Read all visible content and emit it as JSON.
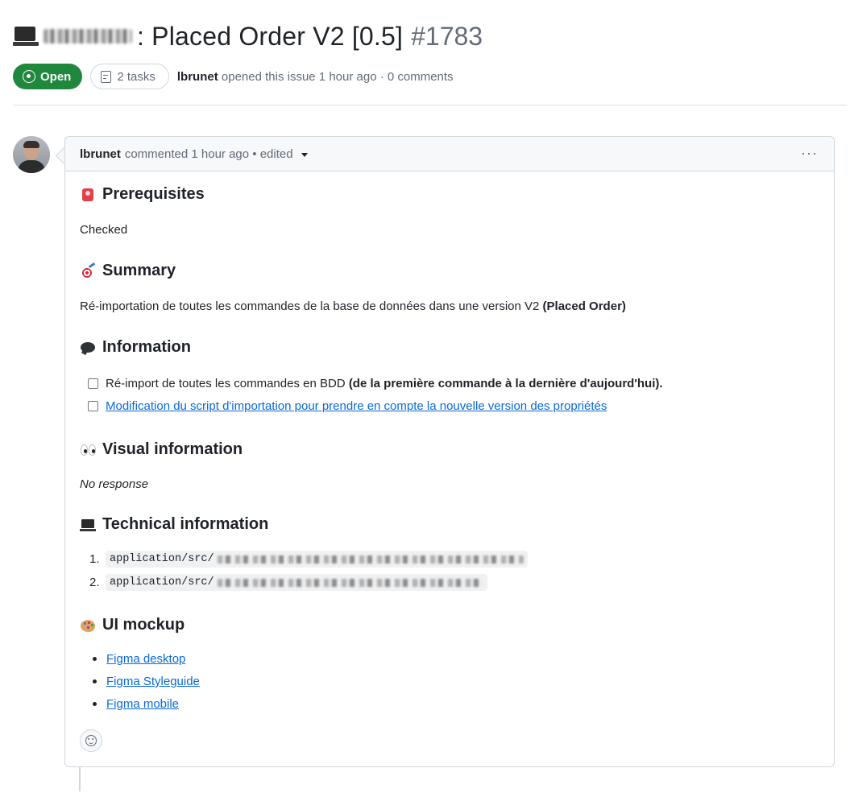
{
  "issue": {
    "title": ": Placed Order V2 [0.5]",
    "number": "#1783",
    "state": "Open",
    "tasks_label": "2 tasks",
    "author": "lbrunet",
    "meta_suffix": "opened this issue 1 hour ago · 0 comments"
  },
  "comment": {
    "author": "lbrunet",
    "meta": "commented 1 hour ago • edited",
    "menu_label": "···",
    "sections": {
      "prerequisites": {
        "title": "Prerequisites",
        "text": "Checked"
      },
      "summary": {
        "title": "Summary",
        "text": "Ré-importation de toutes les commandes de la base de données dans une version V2",
        "bold": "(Placed Order)"
      },
      "information": {
        "title": "Information",
        "tasks": [
          {
            "text": "Ré-import de toutes les commandes en BDD",
            "bold": "(de la première commande à la dernière d'aujourd'hui).",
            "checked": false
          },
          {
            "text": "Modification du script d'importation pour prendre en compte la nouvelle version des propriétés",
            "checked": false
          }
        ]
      },
      "visual": {
        "title": "Visual information",
        "text": "No response"
      },
      "technical": {
        "title": "Technical information",
        "items": [
          {
            "num": "1.",
            "code": "application/src/"
          },
          {
            "num": "2.",
            "code": "application/src/"
          }
        ]
      },
      "mockup": {
        "title": "UI mockup",
        "links": [
          "Figma desktop",
          "Figma Styleguide",
          "Figma mobile"
        ]
      }
    }
  },
  "colors": {
    "open_badge": "#1f883d",
    "link": "#0969da",
    "muted": "#636c76",
    "border": "#d0d7de"
  },
  "icons": [
    "laptop-icon",
    "issue-open-icon",
    "tasklist-icon",
    "kebab-icon",
    "siren-emoji-icon",
    "target-emoji-icon",
    "speech-bubble-emoji-icon",
    "eyes-emoji-icon",
    "laptop-emoji-icon",
    "palette-emoji-icon",
    "smiley-icon"
  ]
}
